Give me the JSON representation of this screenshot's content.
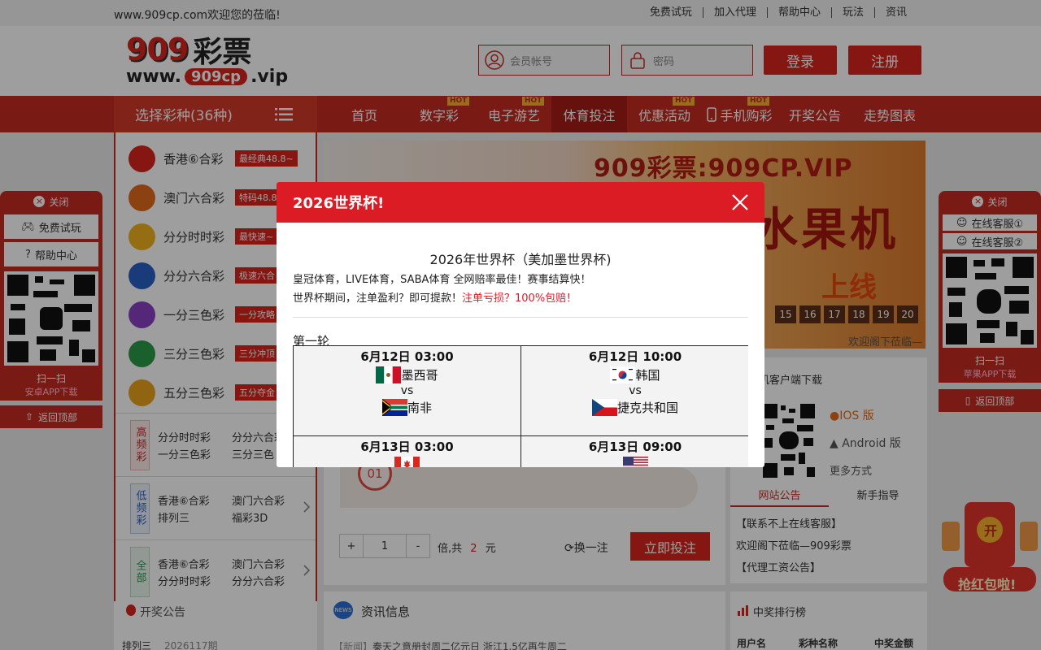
{
  "topbar": {
    "welcome": "www.909cp.com欢迎您的莅临!",
    "links": [
      "免费试玩",
      "加入代理",
      "帮助中心",
      "玩法",
      "资讯"
    ]
  },
  "header": {
    "logo_text": "909彩票",
    "logo_url_text": "www.",
    "logo_url_badge": "909cp",
    "logo_url_tld": ".vip",
    "username_placeholder": "会员帐号",
    "password_placeholder": "密码",
    "login_label": "登录",
    "register_label": "注册"
  },
  "nav": {
    "lottery_header": "选择彩种(36种)",
    "items": [
      {
        "label": "首页",
        "hot": false
      },
      {
        "label": "数字彩",
        "hot": true
      },
      {
        "label": "电子游艺",
        "hot": true
      },
      {
        "label": "体育投注",
        "hot": false,
        "active": true
      },
      {
        "label": "优惠活动",
        "hot": true
      },
      {
        "label": "手机购彩",
        "hot": true
      },
      {
        "label": "开奖公告",
        "hot": false
      },
      {
        "label": "走势图表",
        "hot": false
      }
    ],
    "hot_label": "HOT"
  },
  "lotteries": [
    {
      "name": "香港⑥合彩",
      "tag": "最经典48.8~",
      "color": "#d7251d"
    },
    {
      "name": "澳门六合彩",
      "tag": "特码48.8",
      "color": "#e26b1a"
    },
    {
      "name": "分分时时彩",
      "tag": "最快速~",
      "color": "#f0b21f"
    },
    {
      "name": "分分六合彩",
      "tag": "极速六合",
      "color": "#2b5fc6"
    },
    {
      "name": "一分三色彩",
      "tag": "一分攻略",
      "color": "#8a3fc4"
    },
    {
      "name": "三分三色彩",
      "tag": "三分冲顶",
      "color": "#2a9c4a"
    },
    {
      "name": "五分三色彩",
      "tag": "五分夺金",
      "color": "#e9a21a"
    }
  ],
  "categories": [
    {
      "label": "高频彩",
      "items": [
        "分分时时彩",
        "分分六合彩",
        "一分三色彩",
        "三分三色"
      ],
      "color": "#c62a21"
    },
    {
      "label": "低频彩",
      "items": [
        "香港⑥合彩",
        "澳门六合彩",
        "排列三",
        "福彩3D"
      ],
      "color": "#2b5fc6"
    },
    {
      "label": "全部",
      "items": [
        "香港⑥合彩",
        "澳门六合彩",
        "分分时时彩",
        "分分六合彩"
      ],
      "color": "#2a9c4a"
    }
  ],
  "banner": {
    "headline": "909彩票:909CP.VIP",
    "big": "水果机",
    "sub": "上线",
    "numbers": [
      "15",
      "16",
      "17",
      "18",
      "19",
      "20"
    ],
    "welcome": "欢迎阁下莅临—"
  },
  "bet": {
    "ball": "01",
    "minus": "-",
    "plus": "+",
    "qty": "1",
    "sum_prefix": "倍,共",
    "sum_value": "2",
    "sum_suffix": "元",
    "change": "换一注",
    "submit": "立即投注"
  },
  "download": {
    "title": "手机客户端下载",
    "ios": "IOS 版",
    "android": "Android 版",
    "more": "更多方式",
    "tabs": [
      "网站公告",
      "新手指导"
    ],
    "news": [
      "【联系不上在线客服】",
      "欢迎阁下莅临—909彩票",
      "【代理工资公告】"
    ]
  },
  "info": {
    "title": "资讯信息",
    "line_tag": "【新闻】",
    "line_text": "秦天之意册封周二亿元日 浙江1.5亿再生周二"
  },
  "rank": {
    "title": "中奖排行榜",
    "headers": [
      "用户名",
      "彩种名称",
      "中奖金额"
    ]
  },
  "draw": {
    "title": "开奖公告",
    "game": "排列三",
    "period": "2026117期"
  },
  "leftfloat": {
    "close": "关闭",
    "trial": "免费试玩",
    "help": "帮助中心",
    "scan": "扫一扫",
    "scan_sub": "安卓APP下载",
    "back": "返回顶部"
  },
  "rightfloat": {
    "close": "关闭",
    "service1": "在线客服①",
    "service2": "在线客服②",
    "scan": "扫一扫",
    "scan_sub": "苹果APP下载",
    "back": "返回顶部"
  },
  "redenvelope": {
    "label": "抢红包啦!",
    "open": "开"
  },
  "modal": {
    "title": "2026世界杯!",
    "heading": "2026年世界杯（美加墨世界杯)",
    "line1": "皇冠体育，LIVE体育，SABA体育 全网赔率最佳！赛事结算快！",
    "line2_black": "世界杯期间，注单盈利？即可提款！",
    "line2_red": "注单亏损？100%包赔！",
    "round": "第一轮",
    "vs": "vs",
    "matches": [
      {
        "time": "6月12日 03:00",
        "home": "墨西哥",
        "away": "南非",
        "home_flag": "mexico",
        "away_flag": "south-africa"
      },
      {
        "time": "6月12日 10:00",
        "home": "韩国",
        "away": "捷克共和国",
        "home_flag": "korea",
        "away_flag": "czech"
      },
      {
        "time": "6月13日 03:00",
        "home": "",
        "away": "",
        "home_flag": "canada",
        "away_flag": ""
      },
      {
        "time": "6月13日 09:00",
        "home": "",
        "away": "",
        "home_flag": "usa",
        "away_flag": ""
      }
    ]
  }
}
